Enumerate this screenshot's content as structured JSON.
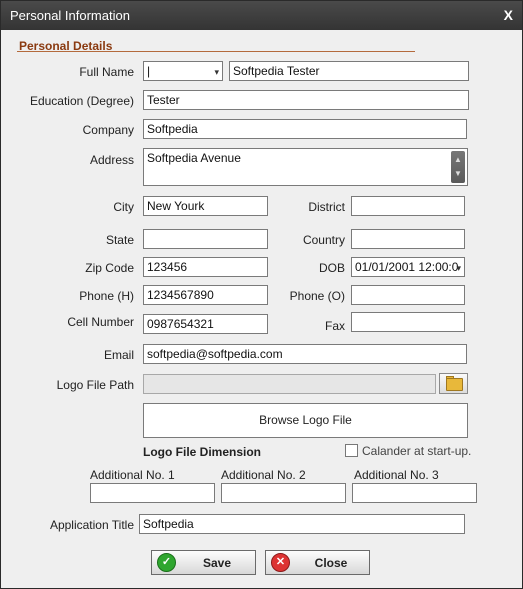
{
  "window": {
    "title": "Personal Information",
    "close_glyph": "X"
  },
  "section_title": "Personal Details",
  "labels": {
    "full_name": "Full Name",
    "education": "Education (Degree)",
    "company": "Company",
    "address": "Address",
    "city": "City",
    "district": "District",
    "state": "State",
    "country": "Country",
    "zip": "Zip Code",
    "dob": "DOB",
    "phone_h": "Phone (H)",
    "phone_o": "Phone (O)",
    "cell": "Cell Number",
    "fax": "Fax",
    "email": "Email",
    "logo_path": "Logo File Path",
    "logo_dim": "Logo File Dimension",
    "additional_1": "Additional No. 1",
    "additional_2": "Additional No. 2",
    "additional_3": "Additional No. 3",
    "app_title": "Application Title"
  },
  "values": {
    "title_prefix": "|",
    "full_name": "Softpedia Tester",
    "education": "Tester",
    "company": "Softpedia",
    "address": "Softpedia Avenue",
    "city": "New Yourk",
    "district": "",
    "state": "",
    "country": "",
    "zip": "123456",
    "dob": "01/01/2001 12:00:0",
    "phone_h": "1234567890",
    "phone_o": "",
    "cell": "0987654321",
    "fax": "",
    "email": "softpedia@softpedia.com",
    "logo_path": "",
    "additional_1": "",
    "additional_2": "",
    "additional_3": "",
    "app_title": "Softpedia"
  },
  "buttons": {
    "browse": "Browse Logo File",
    "save": "Save",
    "close": "Close"
  },
  "checkbox": {
    "calendar_label": "Calander at start-up.",
    "checked": false
  },
  "icons": {
    "combo_arrow": "▾",
    "scroll_up": "▲",
    "scroll_down": "▼",
    "ok": "✓",
    "close": "✕"
  }
}
